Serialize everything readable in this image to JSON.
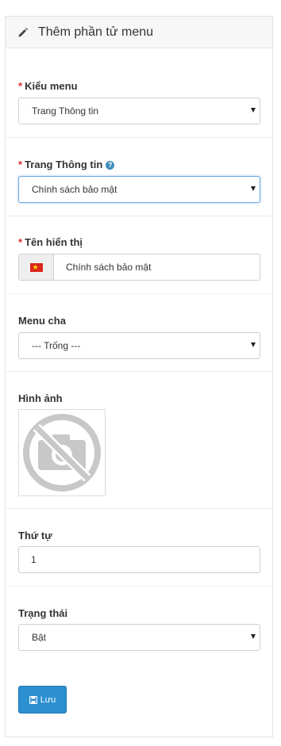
{
  "header": {
    "title": "Thêm phần tử menu",
    "icon": "pencil-icon"
  },
  "fields": {
    "menu_type": {
      "label": "Kiểu menu",
      "required": true,
      "value": "Trang Thông tin"
    },
    "info_page": {
      "label": "Trang Thông tin",
      "required": true,
      "value": "Chính sách bảo mật",
      "help_icon": "question-circle-icon"
    },
    "display_name": {
      "label": "Tên hiển thị",
      "required": true,
      "value": "Chính sách bảo mật",
      "flag_icon": "vietnam-flag-icon"
    },
    "parent_menu": {
      "label": "Menu cha",
      "value": "--- Trống ---"
    },
    "image": {
      "label": "Hình ảnh",
      "placeholder_icon": "no-camera-icon"
    },
    "order": {
      "label": "Thứ tự",
      "value": "1"
    },
    "status": {
      "label": "Trạng thái",
      "value": "Bật"
    }
  },
  "actions": {
    "save_label": "Lưu",
    "save_icon": "floppy-disk-icon"
  },
  "colors": {
    "required": "#d9302f",
    "primary": "#2c8fd0",
    "help": "#3c8dbc"
  }
}
